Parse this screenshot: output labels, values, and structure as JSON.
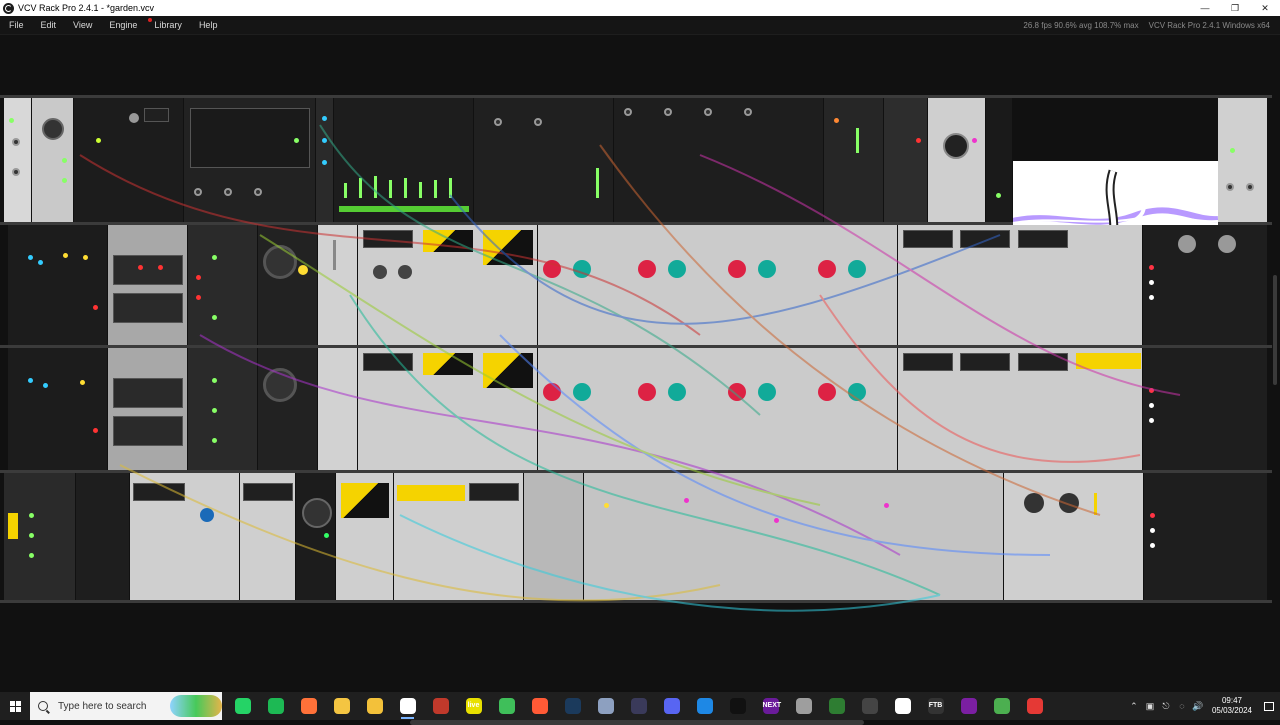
{
  "window": {
    "title": "VCV Rack Pro 2.4.1 - *garden.vcv",
    "controls": [
      "minimize-icon",
      "maximize-icon",
      "close-icon"
    ]
  },
  "menu": {
    "items": [
      "File",
      "Edit",
      "View",
      "Engine",
      "Library",
      "Help"
    ],
    "stats": "26.8 fps  90.6% avg  108.7% max",
    "version": "VCV Rack Pro 2.4.1 Windows x64"
  },
  "taskbar": {
    "search_placeholder": "Type here to search",
    "apps": [
      {
        "name": "whatsapp-icon",
        "color": "#25d366",
        "label": ""
      },
      {
        "name": "spotify-icon",
        "color": "#1db954",
        "label": ""
      },
      {
        "name": "firefox-icon",
        "color": "#ff7139",
        "label": ""
      },
      {
        "name": "media-player-icon",
        "color": "#f4c542",
        "label": ""
      },
      {
        "name": "file-explorer-icon",
        "color": "#f3c13a",
        "label": ""
      },
      {
        "name": "vcv-rack-icon",
        "color": "#ffffff",
        "label": ""
      },
      {
        "name": "app-red-icon",
        "color": "#c0392b",
        "label": ""
      },
      {
        "name": "live-icon",
        "color": "#e8e000",
        "label": "live"
      },
      {
        "name": "shield-icon",
        "color": "#3fbf5a",
        "label": ""
      },
      {
        "name": "colorful-app-icon",
        "color": "#ff5a36",
        "label": ""
      },
      {
        "name": "steam-icon",
        "color": "#1b3a5c",
        "label": ""
      },
      {
        "name": "tool-icon",
        "color": "#8da0c0",
        "label": ""
      },
      {
        "name": "obs-icon",
        "color": "#3a3a5a",
        "label": ""
      },
      {
        "name": "discord-icon",
        "color": "#5865f2",
        "label": ""
      },
      {
        "name": "app-blue-icon",
        "color": "#1e88e5",
        "label": ""
      },
      {
        "name": "capcut-icon",
        "color": "#111111",
        "label": ""
      },
      {
        "name": "next-icon",
        "color": "#6a1b9a",
        "label": "NEXT"
      },
      {
        "name": "app-gray-icon",
        "color": "#9e9e9e",
        "label": ""
      },
      {
        "name": "app-green-icon",
        "color": "#2e7d32",
        "label": ""
      },
      {
        "name": "app-dark-icon",
        "color": "#444444",
        "label": ""
      },
      {
        "name": "app-white-icon",
        "color": "#ffffff",
        "label": ""
      },
      {
        "name": "ftb-icon",
        "color": "#333333",
        "label": "FTB"
      },
      {
        "name": "app-purple-icon",
        "color": "#7b1fa2",
        "label": ""
      },
      {
        "name": "minecraft-icon",
        "color": "#4caf50",
        "label": ""
      },
      {
        "name": "app-red-circle-icon",
        "color": "#e53935",
        "label": ""
      }
    ],
    "tray_icons": [
      "chevron-up-icon",
      "network-adapter-icon",
      "usb-icon",
      "wifi-icon",
      "volume-icon"
    ],
    "time": "09:47",
    "date": "05/03/2024"
  },
  "colors": {
    "accent_yellow": "#f5d300",
    "led_green": "#88ff66",
    "led_red": "#ff3344",
    "led_blue": "#33ccff",
    "rack_bg": "#111111"
  }
}
